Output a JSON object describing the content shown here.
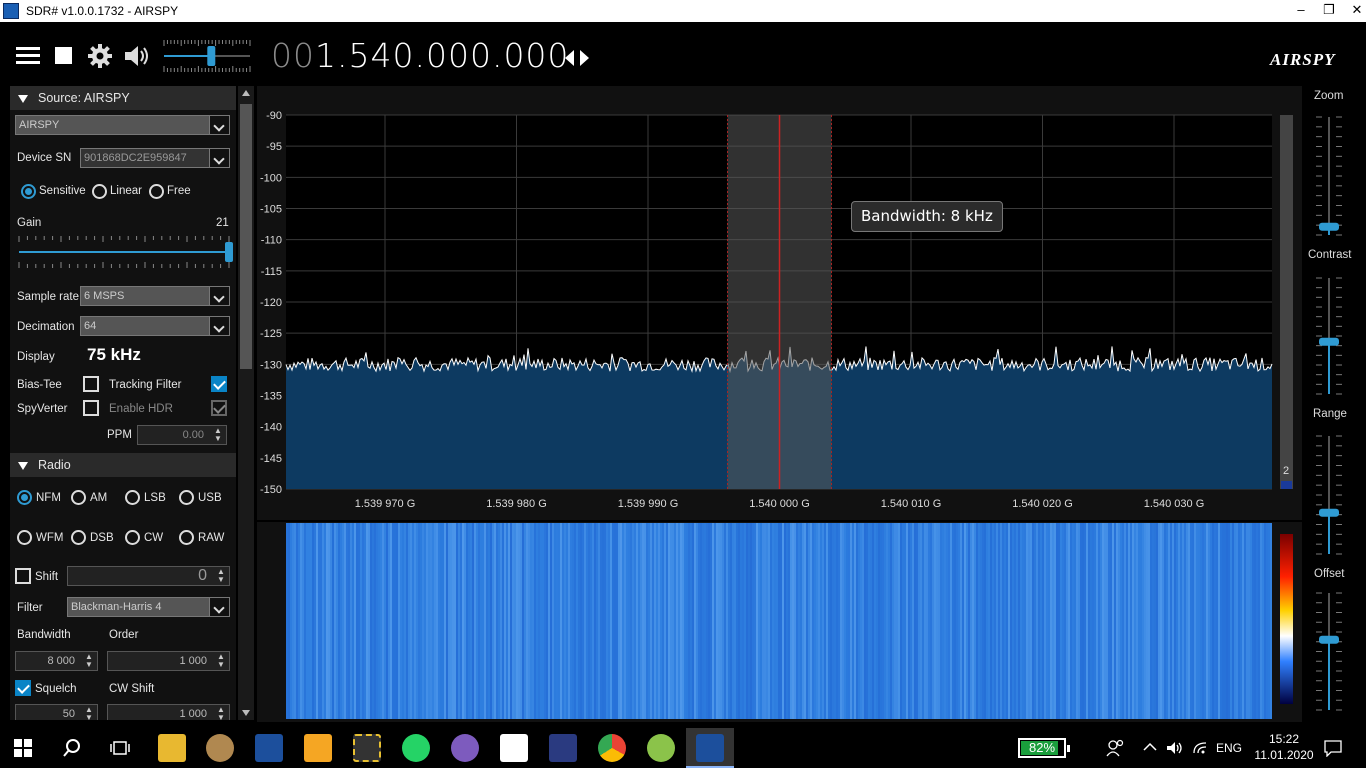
{
  "window": {
    "title": "SDR# v1.0.0.1732 - AIRSPY",
    "minimize": "–",
    "restore": "❐",
    "close": "✕"
  },
  "toolbar": {
    "freq_lead": "00",
    "freq_main": "1.540.000.000",
    "logo": "AIRSPY",
    "volume_level": 0.55
  },
  "source": {
    "header": "Source: AIRSPY",
    "device": "AIRSPY",
    "device_sn_label": "Device SN",
    "device_sn": "901868DC2E959847",
    "modes": [
      "Sensitive",
      "Linear",
      "Free"
    ],
    "mode_selected": "Sensitive",
    "gain_label": "Gain",
    "gain_value": "21",
    "gain_fraction": 1.0,
    "sample_rate_label": "Sample rate",
    "sample_rate": "6 MSPS",
    "decimation_label": "Decimation",
    "decimation": "64",
    "display_label": "Display",
    "display_value": "75 kHz",
    "bias_tee": "Bias-Tee",
    "tracking_filter": "Tracking Filter",
    "spyverter": "SpyVerter",
    "enable_hdr": "Enable HDR",
    "ppm_label": "PPM",
    "ppm_value": "0.00"
  },
  "radio": {
    "header": "Radio",
    "modes_row1": [
      "NFM",
      "AM",
      "LSB",
      "USB"
    ],
    "modes_row2": [
      "WFM",
      "DSB",
      "CW",
      "RAW"
    ],
    "mode_selected": "NFM",
    "shift_label": "Shift",
    "shift_value": "0",
    "filter_label": "Filter",
    "filter_value": "Blackman-Harris 4",
    "bandwidth_label": "Bandwidth",
    "bandwidth_value": "8 000",
    "order_label": "Order",
    "order_value": "1 000",
    "squelch_label": "Squelch",
    "cw_shift_label": "CW Shift",
    "squelch_value": "50",
    "cw_shift_value": "1 000"
  },
  "spectrum": {
    "y_ticks": [
      "-90",
      "-95",
      "-100",
      "-105",
      "-110",
      "-115",
      "-120",
      "-125",
      "-130",
      "-135",
      "-140",
      "-145",
      "-150"
    ],
    "x_ticks": [
      "1.539 970 G",
      "1.539 980 G",
      "1.539 990 G",
      "1.540 000 G",
      "1.540 010 G",
      "1.540 020 G",
      "1.540 030 G"
    ],
    "tooltip": "Bandwidth: 8 kHz",
    "noise_floor_db": -130,
    "scroll_value": "2",
    "colors": {
      "fill": "#0d3a61",
      "trace": "#ffffff",
      "grid": "#3a3a3a",
      "filter_band": "#3a3a3a",
      "center_line": "#cc2222"
    }
  },
  "right_panel": {
    "labels": [
      "Zoom",
      "Contrast",
      "Range",
      "Offset"
    ]
  },
  "taskbar": {
    "battery": "82%",
    "lang": "ENG",
    "time": "15:22",
    "date": "11.01.2020"
  }
}
